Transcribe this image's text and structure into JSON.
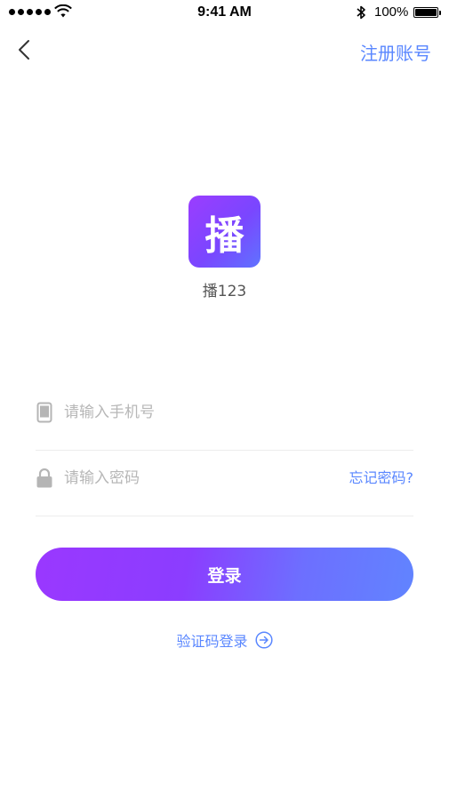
{
  "status_bar": {
    "time": "9:41 AM",
    "battery": "100%"
  },
  "nav": {
    "register_label": "注册账号"
  },
  "app": {
    "logo_char": "播",
    "name": "播123"
  },
  "form": {
    "phone_placeholder": "请输入手机号",
    "phone_value": "",
    "password_placeholder": "请输入密码",
    "password_value": "",
    "forgot_label": "忘记密码?"
  },
  "actions": {
    "login_label": "登录",
    "code_login_label": "验证码登录"
  },
  "colors": {
    "accent": "#5a87ff",
    "gradient_start": "#9a38ff",
    "gradient_end": "#6184ff"
  },
  "icons": {
    "back": "chevron-left-icon",
    "phone": "phone-icon",
    "lock": "lock-icon",
    "code_login": "arrow-right-circle-icon"
  }
}
